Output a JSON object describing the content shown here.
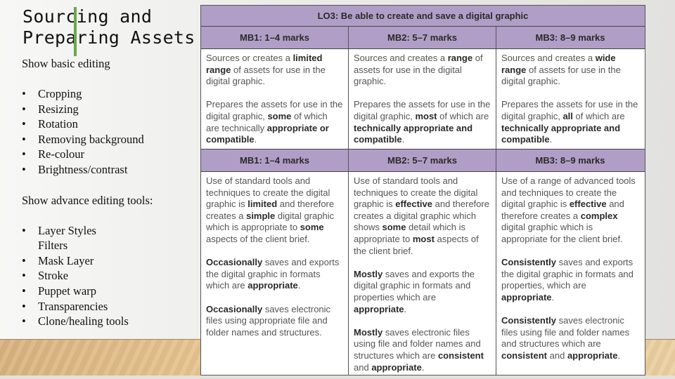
{
  "slide": {
    "title_line1": "Sourcing and",
    "title_line2": "Preparing Assets",
    "basic_heading": "Show basic editing",
    "basic_items": [
      "Cropping",
      "Resizing",
      "Rotation",
      "Removing background",
      "Re-colour",
      "Brightness/contrast"
    ],
    "advanced_heading": "Show advance editing tools:",
    "advanced_items": [
      {
        "bullet": "•",
        "label": "Layer Styles"
      },
      {
        "bullet": "",
        "label": "Filters"
      },
      {
        "bullet": "•",
        "label": "Mask Layer"
      },
      {
        "bullet": "•",
        "label": "Stroke"
      },
      {
        "bullet": "•",
        "label": "Puppet warp"
      },
      {
        "bullet": "•",
        "label": "Transparencies"
      },
      {
        "bullet": "•",
        "label": "Clone/healing tools"
      }
    ],
    "bullet_glyph": "•",
    "accent_color": "#6aa84f"
  },
  "rubric": {
    "title": "LO3: Be able to create and save a digital graphic",
    "header_color": "#b09ec7",
    "section1": {
      "headers": [
        "MB1: 1–4 marks",
        "MB2: 5–7 marks",
        "MB3: 8–9 marks"
      ],
      "cells": [
        [
          [
            {
              "t": "Sources or creates a "
            },
            {
              "b": "limited range"
            },
            {
              "t": " of assets for use in the digital graphic."
            }
          ],
          [
            {
              "t": "Prepares the assets for use in the digital graphic, "
            },
            {
              "b": "some"
            },
            {
              "t": " of which are technically "
            },
            {
              "b": "appropriate or compatible"
            },
            {
              "t": "."
            }
          ]
        ],
        [
          [
            {
              "t": "Sources and creates a "
            },
            {
              "b": "range"
            },
            {
              "t": " of assets for use in the digital graphic."
            }
          ],
          [
            {
              "t": "Prepares the assets for use in the digital graphic, "
            },
            {
              "b": "most"
            },
            {
              "t": " of which are "
            },
            {
              "b": "technically appropriate and compatible"
            },
            {
              "t": "."
            }
          ]
        ],
        [
          [
            {
              "t": "Sources and creates a "
            },
            {
              "b": "wide range"
            },
            {
              "t": " of assets for use in the digital graphic."
            }
          ],
          [
            {
              "t": "Prepares the assets for use in the digital graphic, "
            },
            {
              "b": "all"
            },
            {
              "t": " of which are "
            },
            {
              "b": "technically appropriate and compatible"
            },
            {
              "t": "."
            }
          ]
        ]
      ]
    },
    "section2": {
      "headers": [
        "MB1: 1–4 marks",
        "MB2: 5–7 marks",
        "MB3: 8–9 marks"
      ],
      "cells": [
        [
          [
            {
              "t": "Use of standard tools and techniques to create the digital graphic is "
            },
            {
              "b": "limited"
            },
            {
              "t": " and therefore creates a "
            },
            {
              "b": "simple"
            },
            {
              "t": " digital graphic which is appropriate to "
            },
            {
              "b": "some"
            },
            {
              "t": " aspects of the client brief."
            }
          ],
          [
            {
              "b": "Occasionally"
            },
            {
              "t": " saves and exports the digital graphic in formats which are "
            },
            {
              "b": "appropriate"
            },
            {
              "t": "."
            }
          ],
          [
            {
              "b": "Occasionally"
            },
            {
              "t": " saves electronic files using appropriate file and folder names and structures."
            }
          ]
        ],
        [
          [
            {
              "t": "Use of standard tools and techniques to create the digital graphic is "
            },
            {
              "b": "effective"
            },
            {
              "t": " and therefore creates a digital graphic which shows "
            },
            {
              "b": "some"
            },
            {
              "t": " detail which is appropriate to "
            },
            {
              "b": "most"
            },
            {
              "t": " aspects of the client brief."
            }
          ],
          [
            {
              "b": "Mostly"
            },
            {
              "t": " saves and exports the digital graphic in formats and properties which are "
            },
            {
              "b": "appropriate"
            },
            {
              "t": "."
            }
          ],
          [
            {
              "b": "Mostly"
            },
            {
              "t": " saves electronic files using file and folder names and structures which are "
            },
            {
              "b": "consistent"
            },
            {
              "t": " and "
            },
            {
              "b": "appropriate"
            },
            {
              "t": "."
            }
          ]
        ],
        [
          [
            {
              "t": "Use of a range of advanced tools and techniques to create the digital graphic is "
            },
            {
              "b": "effective"
            },
            {
              "t": " and therefore creates a "
            },
            {
              "b": "complex"
            },
            {
              "t": " digital graphic which is appropriate for the client brief."
            }
          ],
          [
            {
              "b": "Consistently"
            },
            {
              "t": " saves and exports the digital graphic in formats and properties, which are "
            },
            {
              "b": "appropriate"
            },
            {
              "t": "."
            }
          ],
          [
            {
              "b": "Consistently"
            },
            {
              "t": " saves electronic files using file and folder names and structures which are "
            },
            {
              "b": "consistent"
            },
            {
              "t": " and "
            },
            {
              "b": "appropriate"
            },
            {
              "t": "."
            }
          ]
        ]
      ]
    }
  }
}
